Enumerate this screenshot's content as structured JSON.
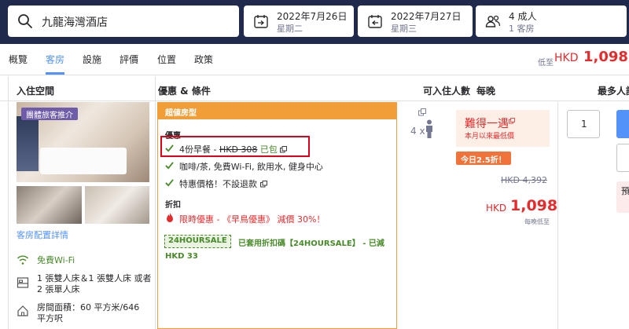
{
  "search": {
    "destination": "九龍海灣酒店",
    "checkin_date": "2022年7月26日",
    "checkin_day": "星期二",
    "checkout_date": "2022年7月27日",
    "checkout_day": "星期三",
    "guests": "4 成人",
    "rooms": "1 客房"
  },
  "tabs": [
    {
      "label": "概覽"
    },
    {
      "label": "客房"
    },
    {
      "label": "設施"
    },
    {
      "label": "評價"
    },
    {
      "label": "位置"
    },
    {
      "label": "政策"
    }
  ],
  "header_price": {
    "prefix": "低至",
    "currency": "HKD",
    "value": "1,098"
  },
  "table_headers": {
    "room": "入住空間",
    "deal": "優惠 & 條件",
    "occupancy": "可入住人數",
    "price": "每晚",
    "max": "最多人記"
  },
  "room": {
    "group_badge": "團體旅客推介",
    "details_link": "客房配置詳情",
    "wifi": "免費Wi-Fi",
    "bed_line1": "1 張雙人床＆1 張雙人床 或者",
    "bed_line2": "2 張單人床",
    "size_line1": "房間面積：60 平方米/646",
    "size_line2": "平方呎"
  },
  "deal": {
    "header": "超値房型",
    "benefits_title": "優惠",
    "breakfast_prefix": "4份早餐 -",
    "breakfast_price": "HKD 308",
    "breakfast_included": "已包",
    "amenities": "咖啡/茶, 免費Wi-Fi, 飲用水, 健身中心",
    "nonrefundable": "特惠價格！不設退款",
    "discount_title": "折扣",
    "early_bird": "限時優惠 - 《早鳥優惠》 減價 30%！",
    "coupon_code": "24HOURSALE",
    "coupon_text": "已套用折扣碼【24HOURSALE】 - 已減",
    "coupon_amount": "HKD 33"
  },
  "occupancy": {
    "count": "4 x"
  },
  "price": {
    "rare_title": "難得一遇",
    "rare_sub": "本月以來最低價",
    "discount_badge": "今日2.5折！",
    "original": "HKD 4,392",
    "currency": "HKD",
    "value": "1,098",
    "per_night": "每晚低至"
  },
  "quantity": {
    "value": "1"
  },
  "right_edge": {
    "pink_char": "預"
  },
  "colors": {
    "topbar": "#1f2a4d",
    "accent_blue": "#5392f9",
    "deal_orange": "#f19e38",
    "price_red": "#e12d2d",
    "green": "#488a2a",
    "highlight_border": "#e0001b"
  }
}
